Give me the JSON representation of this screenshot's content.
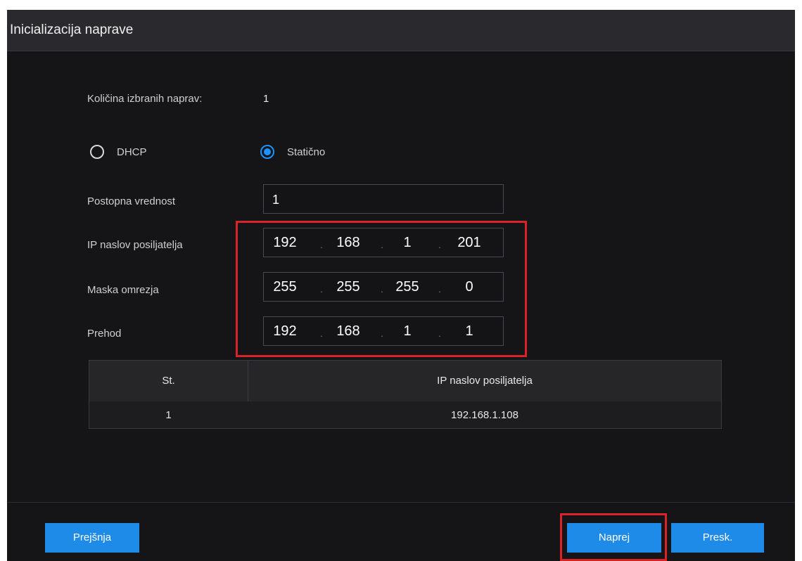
{
  "dialog": {
    "title": "Inicializacija naprave"
  },
  "selected": {
    "label": "Količina izbranih naprav:",
    "value": "1"
  },
  "mode": {
    "options": [
      {
        "label": "DHCP",
        "selected": false
      },
      {
        "label": "Statično",
        "selected": true
      }
    ]
  },
  "increment": {
    "label": "Postopna vrednost",
    "value": "1"
  },
  "ip": {
    "label": "IP naslov posiljatelja",
    "octets": [
      "192",
      "168",
      "1",
      "201"
    ]
  },
  "mask": {
    "label": "Maska omrezja",
    "octets": [
      "255",
      "255",
      "255",
      "0"
    ]
  },
  "gateway": {
    "label": "Prehod",
    "octets": [
      "192",
      "168",
      "1",
      "1"
    ]
  },
  "table": {
    "columns": [
      "St.",
      "IP naslov posiljatelja"
    ],
    "rows": [
      [
        "1",
        "192.168.1.108"
      ]
    ]
  },
  "buttons": {
    "previous": "Prejšnja",
    "next": "Naprej",
    "skip": "Presk."
  },
  "colors": {
    "accent": "#1f8be8",
    "highlight": "#d8232a",
    "background": "#151517"
  }
}
